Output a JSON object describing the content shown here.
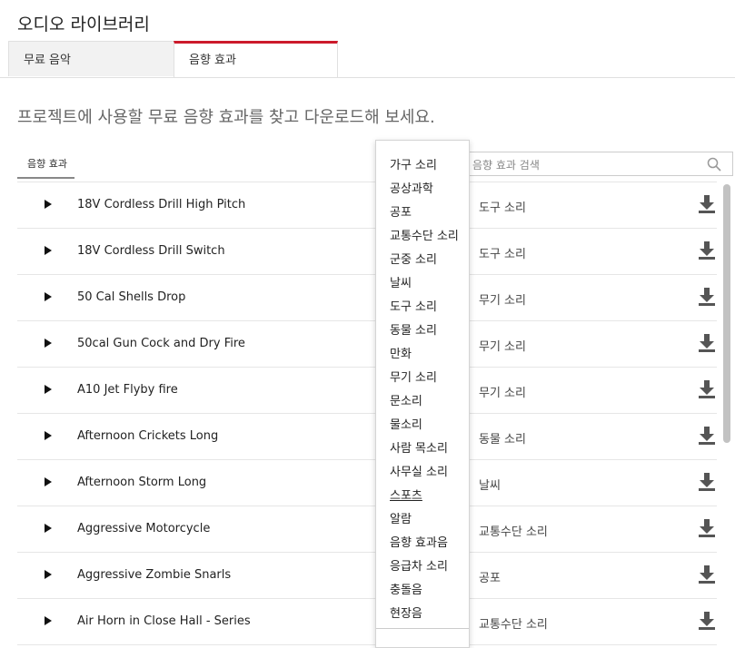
{
  "header": {
    "title": "오디오 라이브러리"
  },
  "tabs": [
    {
      "label": "무료 음악"
    },
    {
      "label": "음향 효과"
    }
  ],
  "subtitle": "프로젝트에 사용할 무료 음향 효과를 찾고 다운로드해 보세요.",
  "filter": {
    "label": "음향 효과"
  },
  "search": {
    "placeholder": "음향 효과 검색"
  },
  "icons": {
    "play": "play-icon",
    "download": "download-icon",
    "search": "search-icon"
  },
  "tracks": [
    {
      "name": "18V Cordless Drill High Pitch",
      "category": "도구 소리"
    },
    {
      "name": "18V Cordless Drill Switch",
      "category": "도구 소리"
    },
    {
      "name": "50 Cal Shells Drop",
      "category": "무기 소리"
    },
    {
      "name": "50cal Gun Cock and Dry Fire",
      "category": "무기 소리"
    },
    {
      "name": "A10 Jet Flyby fire",
      "category": "무기 소리"
    },
    {
      "name": "Afternoon Crickets Long",
      "category": "동물 소리"
    },
    {
      "name": "Afternoon Storm Long",
      "category": "날씨"
    },
    {
      "name": "Aggressive Motorcycle",
      "category": "교통수단 소리"
    },
    {
      "name": "Aggressive Zombie Snarls",
      "category": "공포"
    },
    {
      "name": "Air Horn in Close Hall - Series",
      "category": "교통수단 소리"
    }
  ],
  "dropdown": {
    "items": [
      "가구 소리",
      "공상과학",
      "공포",
      "교통수단 소리",
      "군중 소리",
      "날씨",
      "도구 소리",
      "동물 소리",
      "만화",
      "무기 소리",
      "문소리",
      "물소리",
      "사람 목소리",
      "사무실 소리",
      "스포츠",
      "알람",
      "음향 효과음",
      "응급차 소리",
      "충돌음",
      "현장음"
    ],
    "hovered_item": "스포츠"
  }
}
